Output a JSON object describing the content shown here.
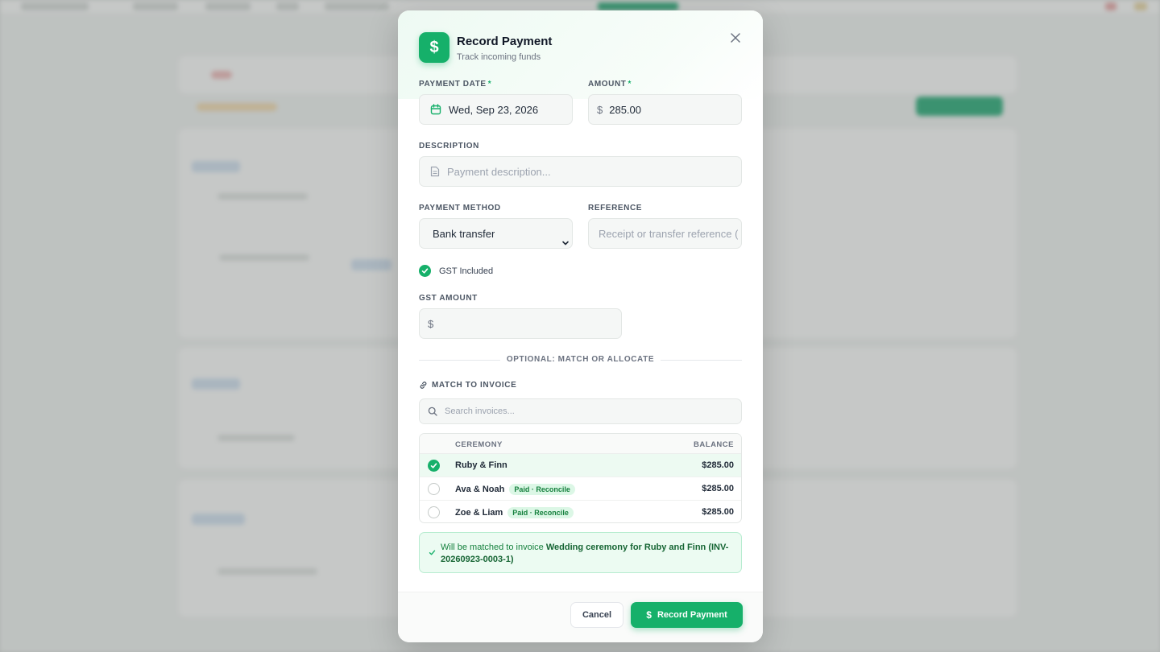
{
  "modal": {
    "title": "Record Payment",
    "subtitle": "Track incoming funds",
    "icon": "dollar-icon"
  },
  "form": {
    "payment_date_label": "PAYMENT DATE",
    "payment_date_value": "Wed, Sep 23, 2026",
    "amount_label": "AMOUNT",
    "amount_currency": "$",
    "amount_value": "285.00",
    "required_mark": "*",
    "description_label": "DESCRIPTION",
    "description_placeholder": "Payment description...",
    "payment_method_label": "PAYMENT METHOD",
    "payment_method_value": "Bank transfer",
    "reference_label": "REFERENCE",
    "reference_placeholder": "Receipt or transfer reference (",
    "gst_included_label": "GST Included",
    "gst_included_checked": true,
    "gst_amount_label": "GST AMOUNT",
    "gst_amount_currency": "$",
    "gst_amount_value": ""
  },
  "match": {
    "divider_text": "OPTIONAL: MATCH OR ALLOCATE",
    "section_label": "MATCH TO INVOICE",
    "search_placeholder": "Search invoices...",
    "columns": {
      "ceremony": "CEREMONY",
      "balance": "BALANCE"
    },
    "rows": [
      {
        "name": "Ruby & Finn",
        "badge": "",
        "balance": "$285.00",
        "selected": true
      },
      {
        "name": "Ava & Noah",
        "badge": "Paid · Reconcile",
        "balance": "$285.00",
        "selected": false
      },
      {
        "name": "Zoe & Liam",
        "badge": "Paid · Reconcile",
        "balance": "$285.00",
        "selected": false
      }
    ],
    "notice_prefix": "Will be matched to invoice ",
    "notice_invoice": "Wedding ceremony for Ruby and Finn (INV-20260923-0003-1)"
  },
  "footer": {
    "cancel_label": "Cancel",
    "submit_label": "Record Payment"
  },
  "colors": {
    "accent": "#16b06a",
    "accent_light": "#ecfbf2",
    "badge_bg": "#dcf7e6"
  }
}
